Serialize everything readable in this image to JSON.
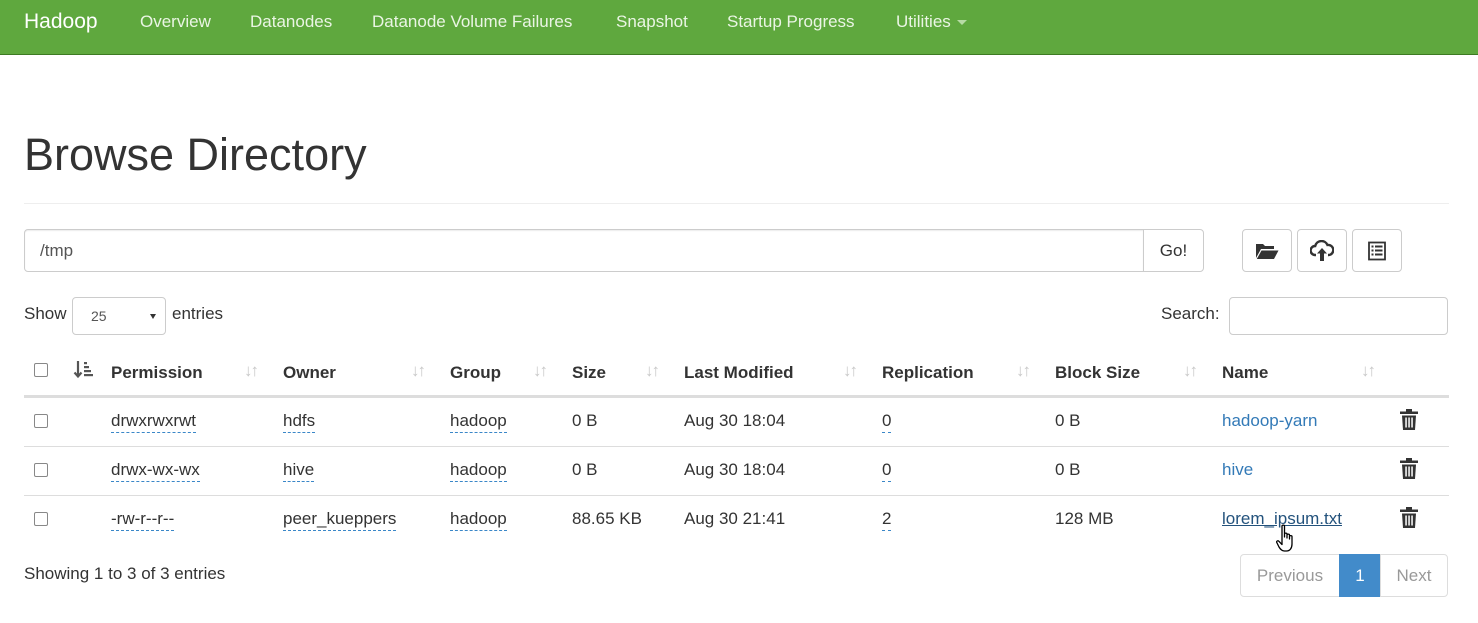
{
  "navbar": {
    "brand": "Hadoop",
    "items": [
      "Overview",
      "Datanodes",
      "Datanode Volume Failures",
      "Snapshot",
      "Startup Progress",
      "Utilities"
    ]
  },
  "page": {
    "title": "Browse Directory"
  },
  "path_bar": {
    "value": "/tmp",
    "go_label": "Go!"
  },
  "toolbar": {
    "buttons": [
      "folder-open-icon",
      "cloud-upload-icon",
      "list-icon"
    ]
  },
  "table_controls": {
    "show_label": "Show",
    "page_length": "25",
    "entries_label": "entries",
    "search_label": "Search:",
    "search_value": ""
  },
  "table": {
    "columns": [
      "Permission",
      "Owner",
      "Group",
      "Size",
      "Last Modified",
      "Replication",
      "Block Size",
      "Name"
    ],
    "rows": [
      {
        "permission": "drwxrwxrwt",
        "owner": "hdfs",
        "group": "hadoop",
        "size": "0 B",
        "modified": "Aug 30 18:04",
        "replication": "0",
        "block_size": "0 B",
        "name": "hadoop-yarn"
      },
      {
        "permission": "drwx-wx-wx",
        "owner": "hive",
        "group": "hadoop",
        "size": "0 B",
        "modified": "Aug 30 18:04",
        "replication": "0",
        "block_size": "0 B",
        "name": "hive"
      },
      {
        "permission": "-rw-r--r--",
        "owner": "peer_kueppers",
        "group": "hadoop",
        "size": "88.65 KB",
        "modified": "Aug 30 21:41",
        "replication": "2",
        "block_size": "128 MB",
        "name": "lorem_ipsum.txt"
      }
    ]
  },
  "footer": {
    "info": "Showing 1 to 3 of 3 entries",
    "previous": "Previous",
    "current_page": "1",
    "next": "Next"
  },
  "colors": {
    "navbar": "#5fa83e",
    "link": "#337ab7",
    "active_page": "#428bca"
  }
}
